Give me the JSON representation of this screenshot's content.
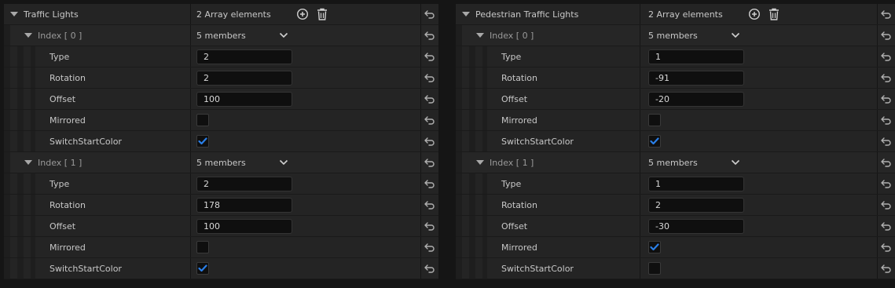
{
  "panels": [
    {
      "title": "Traffic Lights",
      "array_summary": "2 Array elements",
      "indices": [
        {
          "label": "Index [ 0 ]",
          "summary": "5 members",
          "type": "2",
          "rotation": "2",
          "offset": "100",
          "mirrored": false,
          "switch_start_color": true
        },
        {
          "label": "Index [ 1 ]",
          "summary": "5 members",
          "type": "2",
          "rotation": "178",
          "offset": "100",
          "mirrored": false,
          "switch_start_color": true
        }
      ]
    },
    {
      "title": "Pedestrian Traffic Lights",
      "array_summary": "2 Array elements",
      "indices": [
        {
          "label": "Index [ 0 ]",
          "summary": "5 members",
          "type": "1",
          "rotation": "-91",
          "offset": "-20",
          "mirrored": false,
          "switch_start_color": true
        },
        {
          "label": "Index [ 1 ]",
          "summary": "5 members",
          "type": "1",
          "rotation": "2",
          "offset": "-30",
          "mirrored": true,
          "switch_start_color": false
        }
      ]
    }
  ],
  "field_labels": {
    "type": "Type",
    "rotation": "Rotation",
    "offset": "Offset",
    "mirrored": "Mirrored",
    "switch_start_color": "SwitchStartColor"
  },
  "icons": {
    "add": "plus-circle-icon",
    "delete": "trash-icon",
    "reset": "reset-arrow-icon",
    "expand": "triangle-down-icon",
    "dropdown": "chevron-down-icon",
    "check": "checkmark-icon"
  },
  "colors": {
    "panel_bg": "#242424",
    "check_accent": "#2a7fe8",
    "input_bg": "#0f0f0f"
  }
}
